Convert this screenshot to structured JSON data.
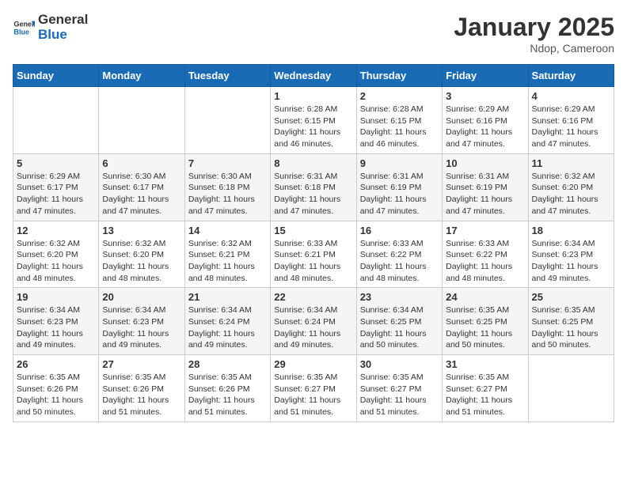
{
  "header": {
    "logo_general": "General",
    "logo_blue": "Blue",
    "month_title": "January 2025",
    "location": "Ndop, Cameroon"
  },
  "days_of_week": [
    "Sunday",
    "Monday",
    "Tuesday",
    "Wednesday",
    "Thursday",
    "Friday",
    "Saturday"
  ],
  "weeks": [
    [
      {
        "day": "",
        "info": ""
      },
      {
        "day": "",
        "info": ""
      },
      {
        "day": "",
        "info": ""
      },
      {
        "day": "1",
        "info": "Sunrise: 6:28 AM\nSunset: 6:15 PM\nDaylight: 11 hours and 46 minutes."
      },
      {
        "day": "2",
        "info": "Sunrise: 6:28 AM\nSunset: 6:15 PM\nDaylight: 11 hours and 46 minutes."
      },
      {
        "day": "3",
        "info": "Sunrise: 6:29 AM\nSunset: 6:16 PM\nDaylight: 11 hours and 47 minutes."
      },
      {
        "day": "4",
        "info": "Sunrise: 6:29 AM\nSunset: 6:16 PM\nDaylight: 11 hours and 47 minutes."
      }
    ],
    [
      {
        "day": "5",
        "info": "Sunrise: 6:29 AM\nSunset: 6:17 PM\nDaylight: 11 hours and 47 minutes."
      },
      {
        "day": "6",
        "info": "Sunrise: 6:30 AM\nSunset: 6:17 PM\nDaylight: 11 hours and 47 minutes."
      },
      {
        "day": "7",
        "info": "Sunrise: 6:30 AM\nSunset: 6:18 PM\nDaylight: 11 hours and 47 minutes."
      },
      {
        "day": "8",
        "info": "Sunrise: 6:31 AM\nSunset: 6:18 PM\nDaylight: 11 hours and 47 minutes."
      },
      {
        "day": "9",
        "info": "Sunrise: 6:31 AM\nSunset: 6:19 PM\nDaylight: 11 hours and 47 minutes."
      },
      {
        "day": "10",
        "info": "Sunrise: 6:31 AM\nSunset: 6:19 PM\nDaylight: 11 hours and 47 minutes."
      },
      {
        "day": "11",
        "info": "Sunrise: 6:32 AM\nSunset: 6:20 PM\nDaylight: 11 hours and 47 minutes."
      }
    ],
    [
      {
        "day": "12",
        "info": "Sunrise: 6:32 AM\nSunset: 6:20 PM\nDaylight: 11 hours and 48 minutes."
      },
      {
        "day": "13",
        "info": "Sunrise: 6:32 AM\nSunset: 6:20 PM\nDaylight: 11 hours and 48 minutes."
      },
      {
        "day": "14",
        "info": "Sunrise: 6:32 AM\nSunset: 6:21 PM\nDaylight: 11 hours and 48 minutes."
      },
      {
        "day": "15",
        "info": "Sunrise: 6:33 AM\nSunset: 6:21 PM\nDaylight: 11 hours and 48 minutes."
      },
      {
        "day": "16",
        "info": "Sunrise: 6:33 AM\nSunset: 6:22 PM\nDaylight: 11 hours and 48 minutes."
      },
      {
        "day": "17",
        "info": "Sunrise: 6:33 AM\nSunset: 6:22 PM\nDaylight: 11 hours and 48 minutes."
      },
      {
        "day": "18",
        "info": "Sunrise: 6:34 AM\nSunset: 6:23 PM\nDaylight: 11 hours and 49 minutes."
      }
    ],
    [
      {
        "day": "19",
        "info": "Sunrise: 6:34 AM\nSunset: 6:23 PM\nDaylight: 11 hours and 49 minutes."
      },
      {
        "day": "20",
        "info": "Sunrise: 6:34 AM\nSunset: 6:23 PM\nDaylight: 11 hours and 49 minutes."
      },
      {
        "day": "21",
        "info": "Sunrise: 6:34 AM\nSunset: 6:24 PM\nDaylight: 11 hours and 49 minutes."
      },
      {
        "day": "22",
        "info": "Sunrise: 6:34 AM\nSunset: 6:24 PM\nDaylight: 11 hours and 49 minutes."
      },
      {
        "day": "23",
        "info": "Sunrise: 6:34 AM\nSunset: 6:25 PM\nDaylight: 11 hours and 50 minutes."
      },
      {
        "day": "24",
        "info": "Sunrise: 6:35 AM\nSunset: 6:25 PM\nDaylight: 11 hours and 50 minutes."
      },
      {
        "day": "25",
        "info": "Sunrise: 6:35 AM\nSunset: 6:25 PM\nDaylight: 11 hours and 50 minutes."
      }
    ],
    [
      {
        "day": "26",
        "info": "Sunrise: 6:35 AM\nSunset: 6:26 PM\nDaylight: 11 hours and 50 minutes."
      },
      {
        "day": "27",
        "info": "Sunrise: 6:35 AM\nSunset: 6:26 PM\nDaylight: 11 hours and 51 minutes."
      },
      {
        "day": "28",
        "info": "Sunrise: 6:35 AM\nSunset: 6:26 PM\nDaylight: 11 hours and 51 minutes."
      },
      {
        "day": "29",
        "info": "Sunrise: 6:35 AM\nSunset: 6:27 PM\nDaylight: 11 hours and 51 minutes."
      },
      {
        "day": "30",
        "info": "Sunrise: 6:35 AM\nSunset: 6:27 PM\nDaylight: 11 hours and 51 minutes."
      },
      {
        "day": "31",
        "info": "Sunrise: 6:35 AM\nSunset: 6:27 PM\nDaylight: 11 hours and 51 minutes."
      },
      {
        "day": "",
        "info": ""
      }
    ]
  ]
}
